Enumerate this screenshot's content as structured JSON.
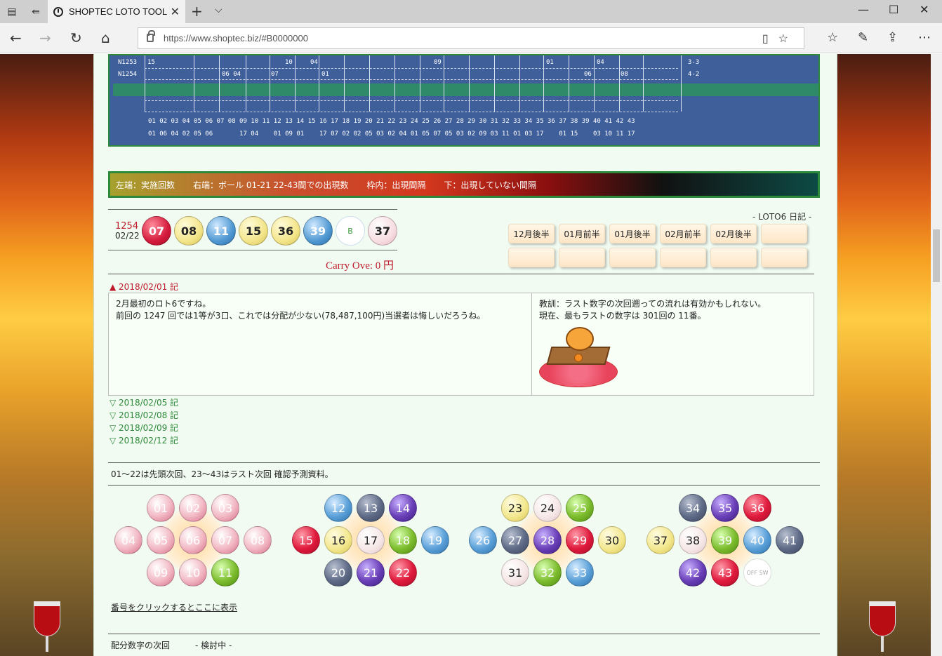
{
  "browser": {
    "tab_title": "SHOPTEC LOTO TOOL",
    "url": "https://www.shoptec.biz/#B0000000"
  },
  "grid": {
    "row_labels": [
      "N1253",
      "N1254"
    ],
    "row1_values": [
      "15",
      "10",
      "04",
      "09",
      "01",
      "04",
      "3-3"
    ],
    "row2_values": [
      "06 04",
      "07",
      "01",
      "06",
      "08",
      "4-2"
    ],
    "number_row": "01 02 03 04 05 06 07 08 09 10 11 12 13 14 15 16 17 18 19 20 21 22 23 24 25 26 27 28 29 30 31 32 33 34 35 36 37 38 39 40 41 42 43",
    "interval_row": "01 06 04 02 05 06       17 04    01 09 01    17 07 02 02 05 03 02 04 01 05 07 05 03 02 09 03 11 01 03 17    01 15    03 10 11 17"
  },
  "legend": {
    "left": "左端：実施回数",
    "right": "右端：ボール 01-21 22-43間での出現数",
    "inside": "枠内：出現間隔",
    "bottom": "下：出現していない間隔"
  },
  "result": {
    "draw_no": "1254",
    "date": "02/22",
    "balls": [
      "07",
      "08",
      "11",
      "15",
      "36",
      "39"
    ],
    "bonus_label": "B",
    "bonus": "37",
    "carry_over": "Carry Ove: 0 円"
  },
  "diary": {
    "title": "- LOTO6 日記 -",
    "buttons": [
      "12月後半",
      "01月前半",
      "01月後半",
      "02月前半",
      "02月後半",
      "",
      "",
      "",
      "",
      "",
      "",
      ""
    ]
  },
  "entry": {
    "head": "▲ 2018/02/01 記",
    "left_line1": "2月最初のロト6ですね。",
    "left_line2": "前回の 1247 回では1等が3口、これでは分配が少ない(78,487,100円)当選者は悔しいだろうね。",
    "right_line1": "教訓：ラスト数字の次回遡っての流れは有効かもしれない。",
    "right_line2": "現在、最もラストの数字は 301回の 11番。"
  },
  "previous_entries": [
    "▽ 2018/02/05 記",
    "▽ 2018/02/08 記",
    "▽ 2018/02/09 記",
    "▽ 2018/02/12 記"
  ],
  "prediction_note": "01～22は先頭次回、23～43はラスト次回 確認予測資料。",
  "number_groups": [
    [
      "01",
      "02",
      "03",
      "04",
      "05",
      "06",
      "07",
      "08",
      "09",
      "10",
      "11"
    ],
    [
      "12",
      "13",
      "14",
      "15",
      "16",
      "17",
      "18",
      "19",
      "20",
      "21",
      "22"
    ],
    [
      "23",
      "24",
      "25",
      "26",
      "27",
      "28",
      "29",
      "30",
      "31",
      "32",
      "33"
    ],
    [
      "34",
      "35",
      "36",
      "37",
      "38",
      "39",
      "40",
      "41",
      "42",
      "43",
      "OFF SW"
    ]
  ],
  "click_hint": "番号をクリックするとここに表示",
  "footer": {
    "left": "配分数字の次回",
    "right": "- 検討中 -"
  }
}
